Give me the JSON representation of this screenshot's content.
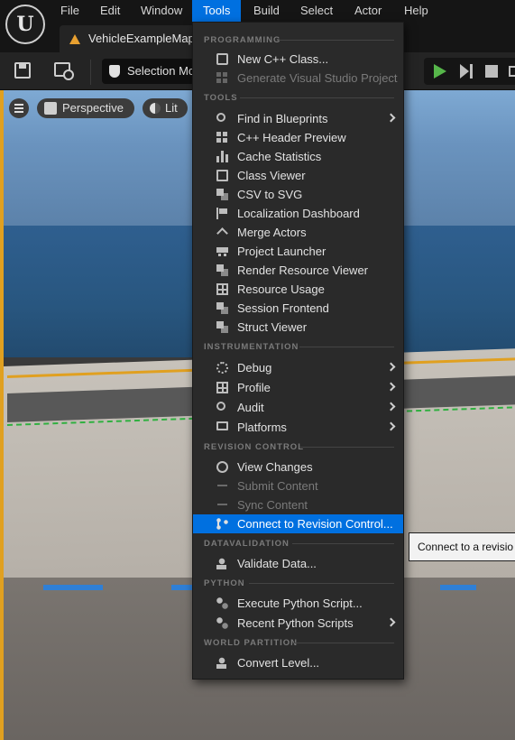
{
  "menubar": {
    "logo_letter": "U",
    "items": [
      "File",
      "Edit",
      "Window",
      "Tools",
      "Build",
      "Select",
      "Actor",
      "Help"
    ],
    "active_index": 3
  },
  "tab": {
    "label": "VehicleExampleMap"
  },
  "toolbar": {
    "selection_mode": "Selection Mo"
  },
  "viewport": {
    "view_mode": "Perspective",
    "lighting": "Lit"
  },
  "dropdown": {
    "sections": {
      "programming": "PROGRAMMING",
      "tools": "TOOLS",
      "instrumentation": "INSTRUMENTATION",
      "revision_control": "REVISION CONTROL",
      "datavalidation": "DATAVALIDATION",
      "python": "PYTHON",
      "world_partition": "WORLD PARTITION"
    },
    "items": {
      "new_cpp_class": "New C++ Class...",
      "gen_vs_project": "Generate Visual Studio Project",
      "find_in_blueprints": "Find in Blueprints",
      "cpp_header_preview": "C++ Header Preview",
      "cache_statistics": "Cache Statistics",
      "class_viewer": "Class Viewer",
      "csv_to_svg": "CSV to SVG",
      "localization_dashboard": "Localization Dashboard",
      "merge_actors": "Merge Actors",
      "project_launcher": "Project Launcher",
      "render_resource_viewer": "Render Resource Viewer",
      "resource_usage": "Resource Usage",
      "session_frontend": "Session Frontend",
      "struct_viewer": "Struct Viewer",
      "debug": "Debug",
      "profile": "Profile",
      "audit": "Audit",
      "platforms": "Platforms",
      "view_changes": "View Changes",
      "submit_content": "Submit Content",
      "sync_content": "Sync Content",
      "connect_to_revision_control": "Connect to Revision Control...",
      "validate_data": "Validate Data...",
      "execute_python_script": "Execute Python Script...",
      "recent_python_scripts": "Recent Python Scripts",
      "convert_level": "Convert Level..."
    }
  },
  "tooltip": {
    "text": "Connect to a revisio"
  },
  "colors": {
    "accent": "#0070e0",
    "menu_bg": "#2a2a2a",
    "play_green": "#56b64a",
    "selection_orange": "#e0a020"
  }
}
